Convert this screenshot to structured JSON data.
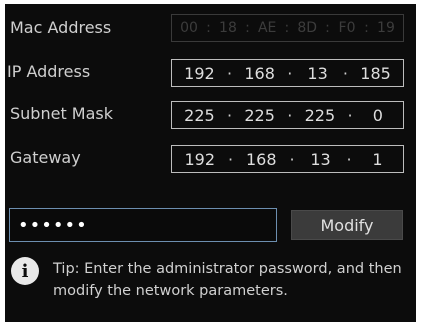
{
  "fields": {
    "mac": {
      "label": "Mac Address",
      "segments": [
        "00",
        "18",
        "AE",
        "8D",
        "F0",
        "19"
      ]
    },
    "ip": {
      "label": "IP Address",
      "segments": [
        "192",
        "168",
        "13",
        "185"
      ]
    },
    "subnet": {
      "label": "Subnet Mask",
      "segments": [
        "225",
        "225",
        "225",
        "0"
      ]
    },
    "gateway": {
      "label": "Gateway",
      "segments": [
        "192",
        "168",
        "13",
        "1"
      ]
    }
  },
  "password": {
    "value": "••••••"
  },
  "modify_button": {
    "label": "Modify"
  },
  "tip": {
    "prefix": "Tip:",
    "text": "Enter the administrator password, and then modify the network parameters."
  },
  "icons": {
    "info": "info-icon"
  },
  "colors": {
    "background": "#0c0c0c",
    "text": "#d6d6d6",
    "field_border": "#bdbdbd",
    "disabled": "#3c3c3c",
    "password_border": "#6d8fb0",
    "button_bg": "#3b3b3b"
  }
}
